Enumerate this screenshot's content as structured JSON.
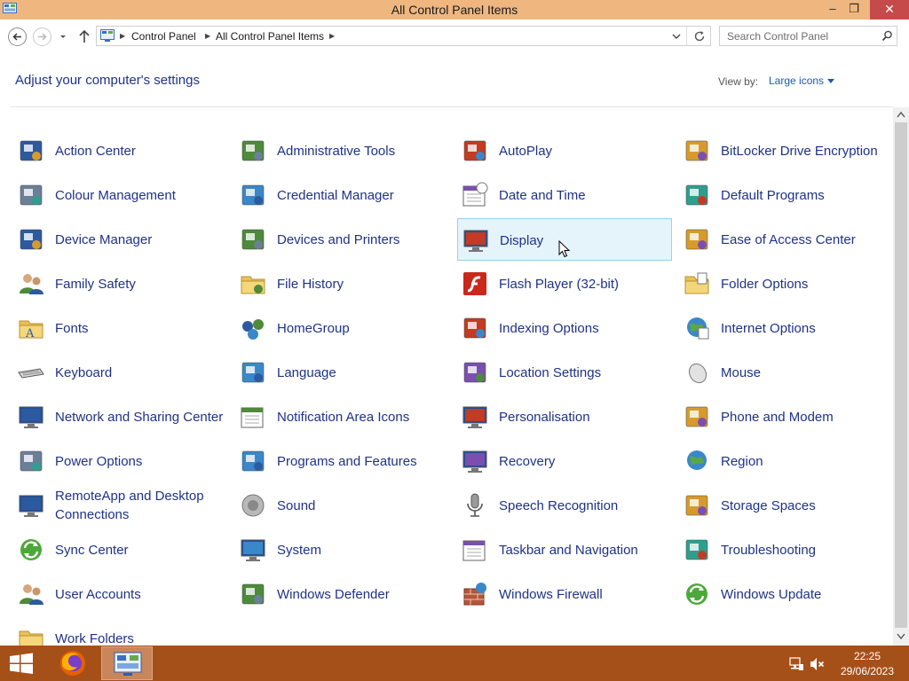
{
  "window": {
    "title": "All Control Panel Items",
    "minimize_glyph": "–",
    "restore_glyph": "❐",
    "close_glyph": "✕"
  },
  "nav": {
    "breadcrumb": [
      "Control Panel",
      "All Control Panel Items"
    ],
    "search_placeholder": "Search Control Panel"
  },
  "header": {
    "title": "Adjust your computer's settings",
    "view_by_label": "View by:",
    "view_by_value": "Large icons"
  },
  "items": [
    {
      "label": "Action Center",
      "icon": "action-center-flag-icon"
    },
    {
      "label": "Administrative Tools",
      "icon": "administrative-tools-icon"
    },
    {
      "label": "AutoPlay",
      "icon": "autoplay-icon"
    },
    {
      "label": "BitLocker Drive Encryption",
      "icon": "bitlocker-key-icon"
    },
    {
      "label": "Colour Management",
      "icon": "colour-management-icon"
    },
    {
      "label": "Credential Manager",
      "icon": "credential-manager-vault-icon"
    },
    {
      "label": "Date and Time",
      "icon": "date-time-calendar-icon"
    },
    {
      "label": "Default Programs",
      "icon": "default-programs-icon"
    },
    {
      "label": "Device Manager",
      "icon": "device-manager-icon"
    },
    {
      "label": "Devices and Printers",
      "icon": "devices-printers-icon"
    },
    {
      "label": "Display",
      "icon": "display-monitor-icon",
      "selected": true
    },
    {
      "label": "Ease of Access Center",
      "icon": "ease-of-access-icon"
    },
    {
      "label": "Family Safety",
      "icon": "family-safety-icon"
    },
    {
      "label": "File History",
      "icon": "file-history-icon"
    },
    {
      "label": "Flash Player (32-bit)",
      "icon": "flash-player-icon"
    },
    {
      "label": "Folder Options",
      "icon": "folder-options-icon"
    },
    {
      "label": "Fonts",
      "icon": "fonts-folder-icon"
    },
    {
      "label": "HomeGroup",
      "icon": "homegroup-icon"
    },
    {
      "label": "Indexing Options",
      "icon": "indexing-options-icon"
    },
    {
      "label": "Internet Options",
      "icon": "internet-options-globe-icon"
    },
    {
      "label": "Keyboard",
      "icon": "keyboard-icon"
    },
    {
      "label": "Language",
      "icon": "language-icon"
    },
    {
      "label": "Location Settings",
      "icon": "location-settings-icon"
    },
    {
      "label": "Mouse",
      "icon": "mouse-icon"
    },
    {
      "label": "Network and Sharing Center",
      "icon": "network-sharing-icon"
    },
    {
      "label": "Notification Area Icons",
      "icon": "notification-area-icon"
    },
    {
      "label": "Personalisation",
      "icon": "personalisation-icon"
    },
    {
      "label": "Phone and Modem",
      "icon": "phone-modem-icon"
    },
    {
      "label": "Power Options",
      "icon": "power-options-icon"
    },
    {
      "label": "Programs and Features",
      "icon": "programs-features-icon"
    },
    {
      "label": "Recovery",
      "icon": "recovery-icon"
    },
    {
      "label": "Region",
      "icon": "region-globe-icon"
    },
    {
      "label": "RemoteApp and Desktop Connections",
      "icon": "remoteapp-icon"
    },
    {
      "label": "Sound",
      "icon": "sound-speaker-icon"
    },
    {
      "label": "Speech Recognition",
      "icon": "speech-microphone-icon"
    },
    {
      "label": "Storage Spaces",
      "icon": "storage-spaces-icon"
    },
    {
      "label": "Sync Center",
      "icon": "sync-center-icon"
    },
    {
      "label": "System",
      "icon": "system-icon"
    },
    {
      "label": "Taskbar and Navigation",
      "icon": "taskbar-navigation-icon"
    },
    {
      "label": "Troubleshooting",
      "icon": "troubleshooting-icon"
    },
    {
      "label": "User Accounts",
      "icon": "user-accounts-icon"
    },
    {
      "label": "Windows Defender",
      "icon": "windows-defender-icon"
    },
    {
      "label": "Windows Firewall",
      "icon": "windows-firewall-icon"
    },
    {
      "label": "Windows Update",
      "icon": "windows-update-icon"
    },
    {
      "label": "Work Folders",
      "icon": "work-folders-icon"
    }
  ],
  "taskbar": {
    "time": "22:25",
    "date": "29/06/2023",
    "pinned": [
      "firefox-icon",
      "control-panel-icon"
    ]
  },
  "colors": {
    "titlebar": "#efb67f",
    "taskbar": "#a65019",
    "link": "#1e3287",
    "selection": "#e5f3fb"
  }
}
